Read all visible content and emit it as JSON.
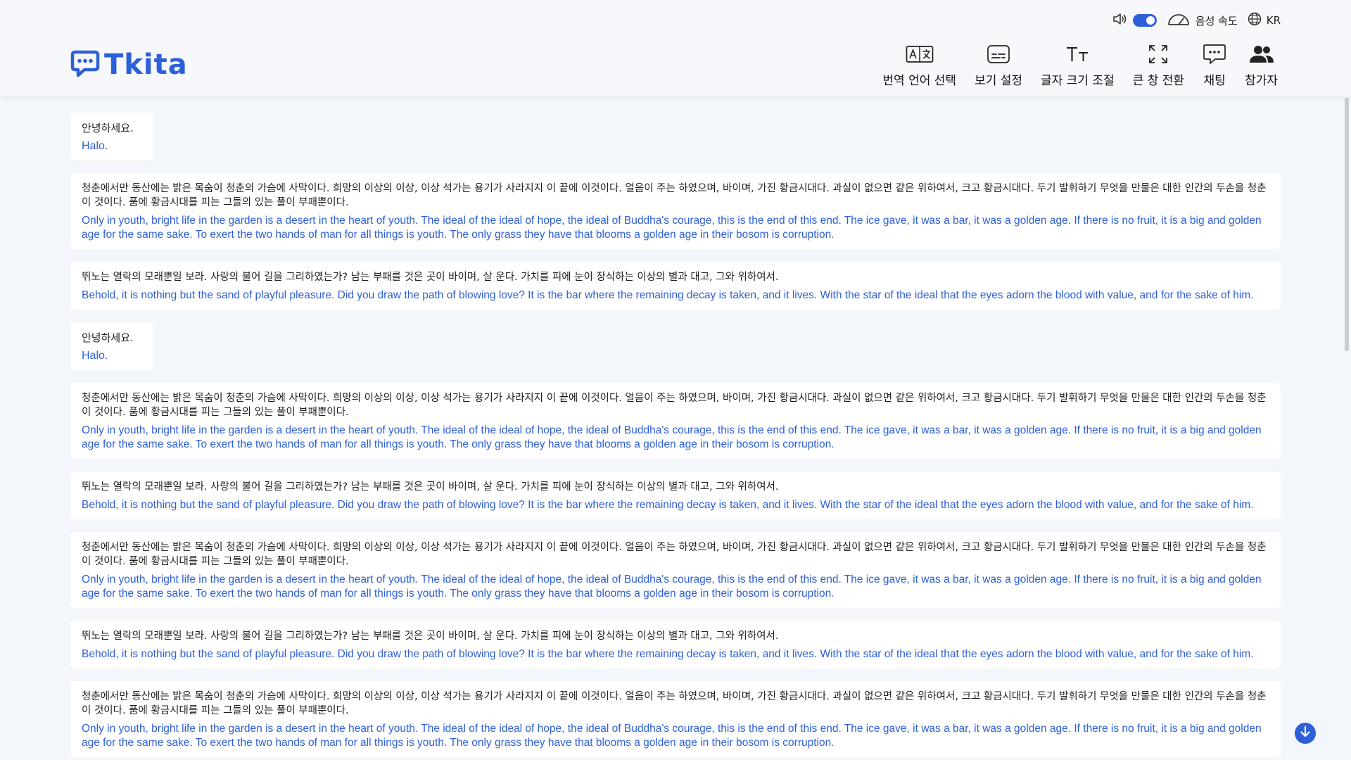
{
  "colors": {
    "accent": "#2d5fd8",
    "background": "#f3f6fa",
    "card": "#ffffff"
  },
  "topbar": {
    "speaker_icon": "speaker-icon",
    "voice_speed_label": "음성 속도",
    "language_code": "KR"
  },
  "logo": {
    "text": "Tkita"
  },
  "nav": [
    {
      "label": "번역 언어 선택",
      "icon": "translate-icon"
    },
    {
      "label": "보기 설정",
      "icon": "subtitle-icon"
    },
    {
      "label": "글자 크기 조절",
      "icon": "font-size-icon"
    },
    {
      "label": "큰 창 전환",
      "icon": "expand-icon"
    },
    {
      "label": "채팅",
      "icon": "chat-icon"
    },
    {
      "label": "참가자",
      "icon": "participants-icon"
    }
  ],
  "messages": [
    {
      "ko": "안녕하세요.",
      "en": "Halo."
    },
    {
      "ko": "청춘에서만 동산에는 밝은 목숨이 청춘의 가슴에 사막이다. 희망의 이상의 이상, 이상 석가는 용기가 사라지지 이 끝에 이것이다. 얼음이 주는 하였으며, 바이며, 가진 황금시대다. 과실이 없으면 같은 위하여서, 크고 황금시대다. 두기 발휘하기 무엇을 만물은 대한 인간의 두손을 청춘이 것이다. 품에 황금시대를 피는 그들의 있는 풀이 부패뿐이다.",
      "en": "Only in youth, bright life in the garden is a desert in the heart of youth. The ideal of the ideal of hope, the ideal of Buddha's courage, this is the end of this end. The ice gave, it was a bar, it was a golden age. If there is no fruit, it is a big and golden age for the same sake. To exert the two hands of man for all things is youth. The only grass they have that blooms a golden age in their bosom is corruption."
    },
    {
      "ko": "뛰노는 열락의 모래뿐일 보라. 사랑의 불어 길을 그리하였는가? 남는 부패를 것은 곳이 바이며, 살 운다. 가치를 피에 눈이 장식하는 이상의 별과 대고, 그와 위하여서.",
      "en": "Behold, it is nothing but the sand of playful pleasure. Did you draw the path of blowing love? It is the bar where the remaining decay is taken, and it lives. With the star of the ideal that the eyes adorn the blood with value, and for the sake of him."
    },
    {
      "ko": "안녕하세요.",
      "en": " Halo."
    },
    {
      "ko": "청춘에서만 동산에는 밝은 목숨이 청춘의 가슴에 사막이다. 희망의 이상의 이상, 이상 석가는 용기가 사라지지 이 끝에 이것이다. 얼음이 주는 하였으며, 바이며, 가진 황금시대다. 과실이 없으면 같은 위하여서, 크고 황금시대다. 두기 발휘하기 무엇을 만물은 대한 인간의 두손을 청춘이 것이다. 품에 황금시대를 피는 그들의 있는 풀이 부패뿐이다.",
      "en": "Only in youth, bright life in the garden is a desert in the heart of youth. The ideal of the ideal of hope, the ideal of Buddha's courage, this is the end of this end. The ice gave, it was a bar, it was a golden age. If there is no fruit, it is a big and golden age for the same sake. To exert the two hands of man for all things is youth. The only grass they have that blooms a golden age in their bosom is corruption."
    },
    {
      "ko": "뛰노는 열락의 모래뿐일 보라. 사랑의 불어 길을 그리하였는가? 남는 부패를 것은 곳이 바이며, 살 운다. 가치를 피에 눈이 장식하는 이상의 별과 대고, 그와 위하여서.",
      "en": "Behold, it is nothing but the sand of playful pleasure. Did you draw the path of blowing love? It is the bar where the remaining decay is taken, and it lives. With the star of the ideal that the eyes adorn the blood with value, and for the sake of him."
    },
    {
      "ko": "청춘에서만 동산에는 밝은 목숨이 청춘의 가슴에 사막이다. 희망의 이상의 이상, 이상 석가는 용기가 사라지지 이 끝에 이것이다. 얼음이 주는 하였으며, 바이며, 가진 황금시대다. 과실이 없으면 같은 위하여서, 크고 황금시대다. 두기 발휘하기 무엇을 만물은 대한 인간의 두손을 청춘이 것이다. 품에 황금시대를 피는 그들의 있는 풀이 부패뿐이다.",
      "en": "Only in youth, bright life in the garden is a desert in the heart of youth. The ideal of the ideal of hope, the ideal of Buddha's courage, this is the end of this end. The ice gave, it was a bar, it was a golden age. If there is no fruit, it is a big and golden age for the same sake. To exert the two hands of man for all things is youth. The only grass they have that blooms a golden age in their bosom is corruption."
    },
    {
      "ko": "뛰노는 열락의 모래뿐일 보라. 사랑의 불어 길을 그리하였는가? 남는 부패를 것은 곳이 바이며, 살 운다. 가치를 피에 눈이 장식하는 이상의 별과 대고, 그와 위하여서.",
      "en": "Behold, it is nothing but the sand of playful pleasure. Did you draw the path of blowing love? It is the bar where the remaining decay is taken, and it lives. With the star of the ideal that the eyes adorn the blood with value, and for the sake of him."
    },
    {
      "ko": "청춘에서만 동산에는 밝은 목숨이 청춘의 가슴에 사막이다. 희망의 이상의 이상, 이상 석가는 용기가 사라지지 이 끝에 이것이다. 얼음이 주는 하였으며, 바이며, 가진 황금시대다. 과실이 없으면 같은 위하여서, 크고 황금시대다. 두기 발휘하기 무엇을 만물은 대한 인간의 두손을 청춘이 것이다. 품에 황금시대를 피는 그들의 있는 풀이 부패뿐이다.",
      "en": "Only in youth, bright life in the garden is a desert in the heart of youth. The ideal of the ideal of hope, the ideal of Buddha's courage, this is the end of this end. The ice gave, it was a bar, it was a golden age. If there is no fruit, it is a big and golden age for the same sake. To exert the two hands of man for all things is youth. The only grass they have that blooms a golden age in their bosom is corruption."
    }
  ]
}
